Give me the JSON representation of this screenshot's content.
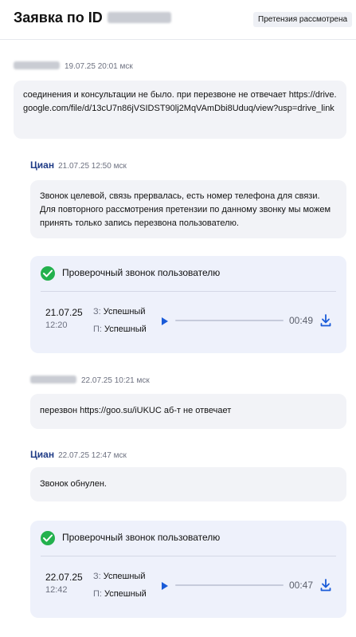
{
  "header": {
    "title": "Заявка по ID",
    "status_badge": "Претензия рассмотрена"
  },
  "messages": [
    {
      "date": "19.07.25 20:01 мск",
      "text": "соединения и консультации не было. при перезвоне не отвечает https://drive.google.com/file/d/13cU7n86jVSIDST90lj2MqVAmDbi8Uduq/view?usp=drive_link"
    },
    {
      "author": "Циан",
      "date": "21.07.25 12:50 мск",
      "text": "Звонок целевой, связь прервалась, есть номер телефона для связи. Для повторного рассмотрения претензии по данному звонку мы можем принять только запись перезвона пользователю."
    },
    {
      "date": "22.07.25 10:21 мск",
      "text": "перезвон https://goo.su/iUKUC аб-т не отвечает"
    },
    {
      "author": "Циан",
      "date": "22.07.25 12:47 мск",
      "text": "Звонок обнулен."
    }
  ],
  "call_cards": [
    {
      "title": "Проверочный звонок пользователю",
      "date": "21.07.25",
      "time": "12:20",
      "status_z_prefix": "З:",
      "status_z": "Успешный",
      "status_p_prefix": "П:",
      "status_p": "Успешный",
      "duration": "00:49",
      "progress": 0
    },
    {
      "title": "Проверочный звонок пользователю",
      "date": "22.07.25",
      "time": "12:42",
      "status_z_prefix": "З:",
      "status_z": "Успешный",
      "status_p_prefix": "П:",
      "status_p": "Успешный",
      "duration": "00:47",
      "progress": 0
    }
  ],
  "icons": {
    "check": "check-circle-icon",
    "play": "play-icon",
    "download": "download-icon"
  },
  "colors": {
    "accent": "#1a5bd8",
    "success": "#23b14d",
    "author": "#1f3b86",
    "card_bg": "#eef1fb",
    "bubble_bg": "#f2f3f7"
  }
}
